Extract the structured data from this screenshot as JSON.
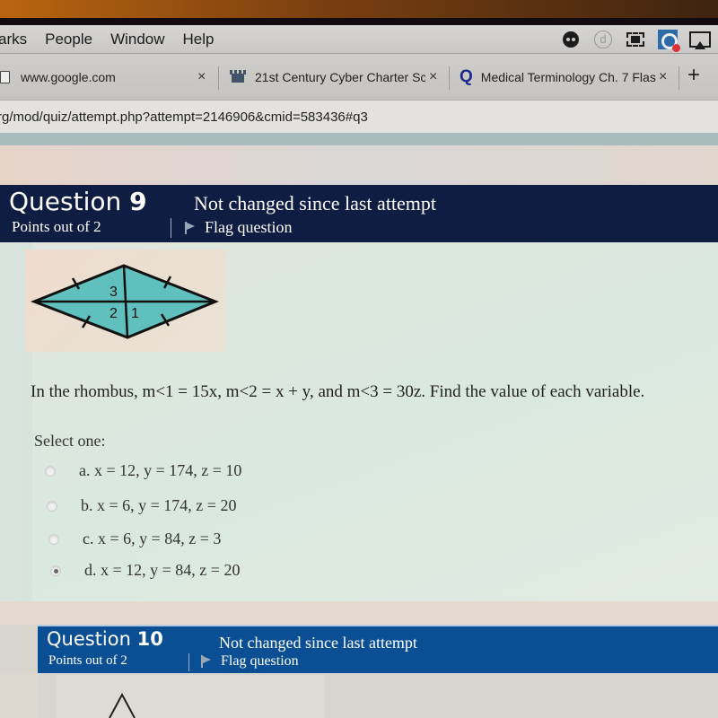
{
  "menubar": {
    "items": [
      "arks",
      "People",
      "Window",
      "Help"
    ],
    "status_icons": [
      "ghost-icon",
      "d-circle-icon",
      "film-strip-icon",
      "screen-recorder-icon",
      "airplay-icon"
    ]
  },
  "tabs": [
    {
      "title": "www.google.com",
      "icon": "document-icon",
      "close": "×"
    },
    {
      "title": "21st Century Cyber Charter Sc",
      "icon": "school-crest-icon",
      "close": "×"
    },
    {
      "title": "Medical Terminology Ch. 7 Flas",
      "icon": "quizlet-q-icon",
      "close": "×"
    }
  ],
  "new_tab_label": "+",
  "address_bar": {
    "url": "rg/mod/quiz/attempt.php?attempt=2146906&cmid=583436#q3"
  },
  "question9": {
    "title_prefix": "Question ",
    "number": "9",
    "points": "Points out of 2",
    "status": "Not changed since last attempt",
    "flag_label": "Flag question",
    "figure": {
      "labels": [
        "3",
        "2",
        "1"
      ],
      "shape": "rhombus with diagonals"
    },
    "text": "In the rhombus, m<1 = 15x, m<2 = x + y, and m<3 = 30z. Find the value of each variable.",
    "select_prompt": "Select one:",
    "options": [
      {
        "label": "a. x = 12, y = 174, z = 10",
        "selected": false
      },
      {
        "label": "b. x = 6, y = 174, z = 20",
        "selected": false
      },
      {
        "label": "c. x = 6, y = 84, z = 3",
        "selected": false
      },
      {
        "label": "d. x = 12, y = 84, z = 20",
        "selected": true
      }
    ]
  },
  "question10": {
    "title_prefix": "Question ",
    "number": "10",
    "points": "Points out of 2",
    "status": "Not changed since last attempt",
    "flag_label": "Flag question"
  },
  "colors": {
    "q9_header": "#0f1d42",
    "q10_header": "#0a4e93",
    "rhombus_fill": "#5fc0bd"
  }
}
